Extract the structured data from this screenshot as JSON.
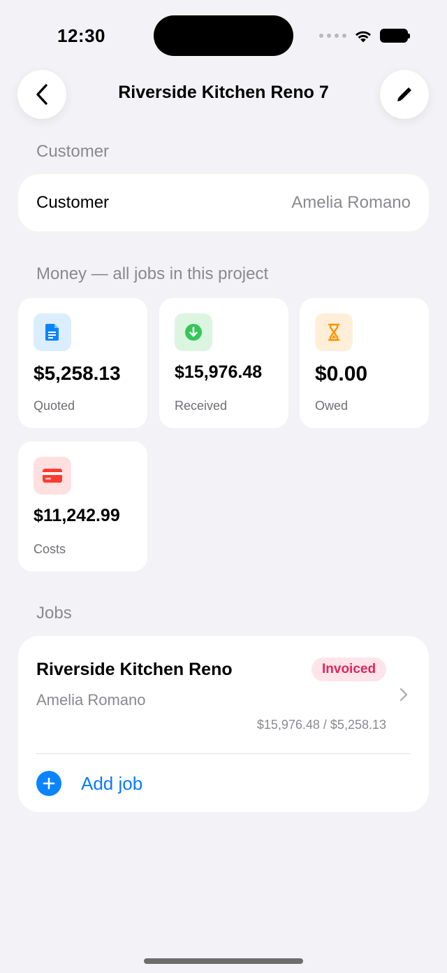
{
  "status_bar": {
    "time": "12:30"
  },
  "nav": {
    "title": "Riverside Kitchen Reno 7",
    "back_icon": "chevron-left",
    "edit_icon": "pencil"
  },
  "customer_section": {
    "header": "Customer",
    "row_label": "Customer",
    "row_value": "Amelia Romano"
  },
  "money_section": {
    "header": "Money — all jobs in this project",
    "cards": [
      {
        "amount": "$5,258.13",
        "label": "Quoted",
        "icon": "document-icon",
        "color": "#0a84ff",
        "bg": "#dbeefe"
      },
      {
        "amount": "$15,976.48",
        "label": "Received",
        "icon": "arrow-down-circle-icon",
        "color": "#34c759",
        "bg": "#dcf5e1"
      },
      {
        "amount": "$0.00",
        "label": "Owed",
        "icon": "hourglass-icon",
        "color": "#ff9500",
        "bg": "#ffefd9"
      },
      {
        "amount": "$11,242.99",
        "label": "Costs",
        "icon": "credit-card-icon",
        "color": "#ff3b30",
        "bg": "#ffe0e0"
      }
    ]
  },
  "jobs_section": {
    "header": "Jobs",
    "jobs": [
      {
        "title": "Riverside Kitchen Reno",
        "status": "Invoiced",
        "customer": "Amelia Romano",
        "amounts": "$15,976.48 / $5,258.13"
      }
    ],
    "add_label": "Add job"
  },
  "colors": {
    "accent": "#0a84ff",
    "badge_text": "#e0245e",
    "badge_bg": "#ffe4ea",
    "background": "#f2f2f7"
  }
}
